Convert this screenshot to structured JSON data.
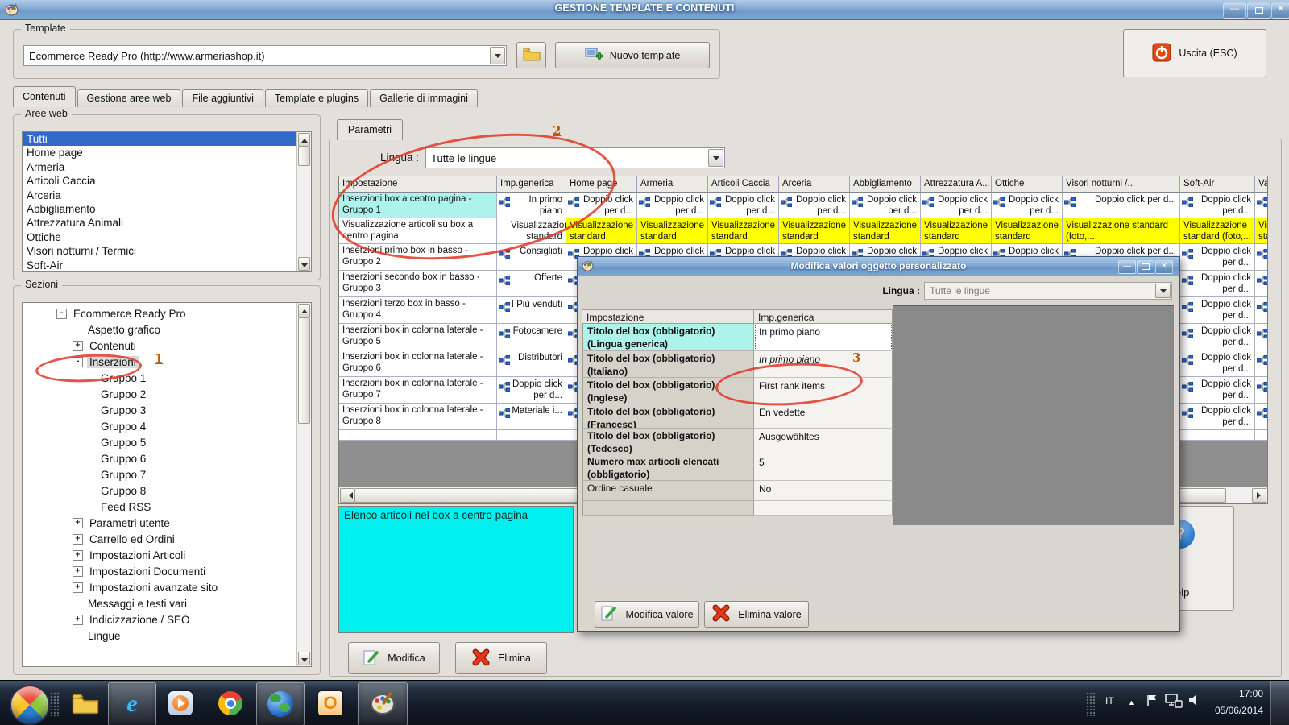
{
  "window": {
    "title": "GESTIONE TEMPLATE E CONTENUTI"
  },
  "template_box": {
    "label": "Template",
    "combo_value": "Ecommerce Ready Pro (http://www.armeriashop.it)",
    "new_template_label": "Nuovo template",
    "exit_label": "Uscita (ESC)"
  },
  "tabs": [
    "Contenuti",
    "Gestione aree web",
    "File aggiuntivi",
    "Template e plugins",
    "Gallerie di immagini"
  ],
  "aree_web": {
    "label": "Aree web",
    "selected_index": 0,
    "items": [
      "Tutti",
      "Home page",
      "Armeria",
      "Articoli Caccia",
      "Arceria",
      "Abbigliamento",
      "Attrezzatura Animali",
      "Ottiche",
      "Visori notturni / Termici",
      "Soft-Air"
    ]
  },
  "sezioni": {
    "label": "Sezioni",
    "tree": [
      {
        "label": "Ecommerce Ready Pro",
        "depth": 0,
        "expander": "minus",
        "highlighted": false
      },
      {
        "label": "Aspetto grafico",
        "depth": 1,
        "expander": "none",
        "highlighted": false
      },
      {
        "label": "Contenuti",
        "depth": 1,
        "expander": "plus",
        "highlighted": false
      },
      {
        "label": "Inserzioni",
        "depth": 1,
        "expander": "minus",
        "highlighted": true
      },
      {
        "label": "Gruppo 1",
        "depth": 2,
        "expander": "none",
        "highlighted": false
      },
      {
        "label": "Gruppo 2",
        "depth": 2,
        "expander": "none",
        "highlighted": false
      },
      {
        "label": "Gruppo 3",
        "depth": 2,
        "expander": "none",
        "highlighted": false
      },
      {
        "label": "Gruppo 4",
        "depth": 2,
        "expander": "none",
        "highlighted": false
      },
      {
        "label": "Gruppo 5",
        "depth": 2,
        "expander": "none",
        "highlighted": false
      },
      {
        "label": "Gruppo 6",
        "depth": 2,
        "expander": "none",
        "highlighted": false
      },
      {
        "label": "Gruppo 7",
        "depth": 2,
        "expander": "none",
        "highlighted": false
      },
      {
        "label": "Gruppo 8",
        "depth": 2,
        "expander": "none",
        "highlighted": false
      },
      {
        "label": "Feed RSS",
        "depth": 2,
        "expander": "none",
        "highlighted": false
      },
      {
        "label": "Parametri utente",
        "depth": 1,
        "expander": "plus",
        "highlighted": false
      },
      {
        "label": "Carrello ed Ordini",
        "depth": 1,
        "expander": "plus",
        "highlighted": false
      },
      {
        "label": "Impostazioni Articoli",
        "depth": 1,
        "expander": "plus",
        "highlighted": false
      },
      {
        "label": "Impostazioni Documenti",
        "depth": 1,
        "expander": "plus",
        "highlighted": false
      },
      {
        "label": "Impostazioni avanzate sito",
        "depth": 1,
        "expander": "plus",
        "highlighted": false
      },
      {
        "label": "Messaggi e testi vari",
        "depth": 1,
        "expander": "none",
        "highlighted": false
      },
      {
        "label": "Indicizzazione / SEO",
        "depth": 1,
        "expander": "plus",
        "highlighted": false
      },
      {
        "label": "Lingue",
        "depth": 1,
        "expander": "none",
        "highlighted": false
      }
    ]
  },
  "parametri": {
    "tab": "Parametri",
    "lingua_label": "Lingua :",
    "lingua_value": "Tutte le lingue"
  },
  "grid": {
    "columns": [
      "Impostazione",
      "Imp.generica",
      "Home page",
      "Armeria",
      "Articoli Caccia",
      "Arceria",
      "Abbigliamento",
      "Attrezzatura A...",
      "Ottiche",
      "Visori notturni /...",
      "Soft-Air",
      "Va"
    ],
    "doppio_text": "Doppio click per d...",
    "visualizzazione_text": "Visualizzazione standard (foto,...",
    "rows": [
      {
        "name": "Inserzioni box a centro pagina - Gruppo 1",
        "selected": true,
        "kind": "doppio",
        "generica": "In primo piano",
        "generica_icon": true
      },
      {
        "name": "Visualizzazione articoli su box a centro pagina",
        "selected": false,
        "kind": "yellow",
        "generica": "Visualizzazione standard (foto,...",
        "generica_icon": false
      },
      {
        "name": "Inserzioni primo box in basso - Gruppo 2",
        "selected": false,
        "kind": "doppio",
        "generica": "Consigliati",
        "generica_icon": true
      },
      {
        "name": "Inserzioni secondo box in basso - Gruppo 3",
        "selected": false,
        "kind": "doppio",
        "generica": "Offerte",
        "generica_icon": true
      },
      {
        "name": "Inserzioni terzo box in basso - Gruppo 4",
        "selected": false,
        "kind": "doppio",
        "generica": "I Più venduti",
        "generica_icon": true
      },
      {
        "name": "Inserzioni box in colonna laterale - Gruppo 5",
        "selected": false,
        "kind": "doppio",
        "generica": "Fotocamere",
        "generica_icon": true
      },
      {
        "name": "Inserzioni box in colonna laterale - Gruppo 6",
        "selected": false,
        "kind": "doppio",
        "generica": "Distributori",
        "generica_icon": true
      },
      {
        "name": "Inserzioni box in colonna laterale - Gruppo 7",
        "selected": false,
        "kind": "doppio",
        "generica": "Doppio click per d...",
        "generica_icon": true
      },
      {
        "name": "Inserzioni box in colonna laterale - Gruppo 8",
        "selected": false,
        "kind": "doppio",
        "generica": "Materiale i...",
        "generica_icon": true
      }
    ]
  },
  "info_box": {
    "text": "Elenco articoli nel box a centro pagina"
  },
  "actions": {
    "modifica": "Modifica",
    "elimina": "Elimina"
  },
  "help": {
    "label": "Help"
  },
  "dialog": {
    "title": "Modifica valori oggetto personalizzato",
    "lingua_label": "Lingua :",
    "lingua_value": "Tutte le lingue",
    "columns": [
      "Impostazione",
      "Imp.generica"
    ],
    "rows": [
      {
        "label": "Titolo del box (obbligatorio)\n(Lingua generica)",
        "value": "In primo piano",
        "bold": true,
        "selected": true,
        "focus": true,
        "italic": false
      },
      {
        "label": "Titolo del box (obbligatorio)\n(Italiano)",
        "value": "In primo piano",
        "bold": true,
        "selected": false,
        "focus": false,
        "italic": true
      },
      {
        "label": "Titolo del box (obbligatorio)\n(Inglese)",
        "value": "First rank items",
        "bold": true,
        "selected": false,
        "focus": false,
        "italic": false
      },
      {
        "label": "Titolo del box (obbligatorio)\n(Francese)",
        "value": "En vedette",
        "bold": true,
        "selected": false,
        "focus": false,
        "italic": false
      },
      {
        "label": "Titolo del box (obbligatorio)\n(Tedesco)",
        "value": "Ausgewähltes",
        "bold": true,
        "selected": false,
        "focus": false,
        "italic": false
      },
      {
        "label": "Numero max articoli elencati\n(obbligatorio)",
        "value": "5",
        "bold": true,
        "selected": false,
        "focus": false,
        "italic": false
      },
      {
        "label": "Ordine casuale",
        "value": "No",
        "bold": false,
        "selected": false,
        "focus": false,
        "italic": false
      }
    ],
    "buttons": {
      "modifica": "Modifica valore",
      "elimina": "Elimina valore"
    }
  },
  "annotations": [
    {
      "n": "1"
    },
    {
      "n": "2"
    },
    {
      "n": "3"
    }
  ],
  "taskbar": {
    "icons": [
      {
        "name": "explorer",
        "pressed": false
      },
      {
        "name": "ie",
        "pressed": true
      },
      {
        "name": "wmp",
        "pressed": false
      },
      {
        "name": "chrome",
        "pressed": false
      },
      {
        "name": "globe",
        "pressed": true
      },
      {
        "name": "outlook",
        "pressed": false
      },
      {
        "name": "palette",
        "pressed": true
      }
    ],
    "tray": {
      "lang": "IT",
      "time": "17:00",
      "date": "05/06/2014"
    }
  },
  "colors": {
    "selection_cyan": "#aef2ec",
    "row_yellow": "#ffff00",
    "info_cyan": "#00efef",
    "annotation_red": "#e03625",
    "annotation_number": "#c05a0a",
    "list_selection_blue": "#3069c8"
  }
}
